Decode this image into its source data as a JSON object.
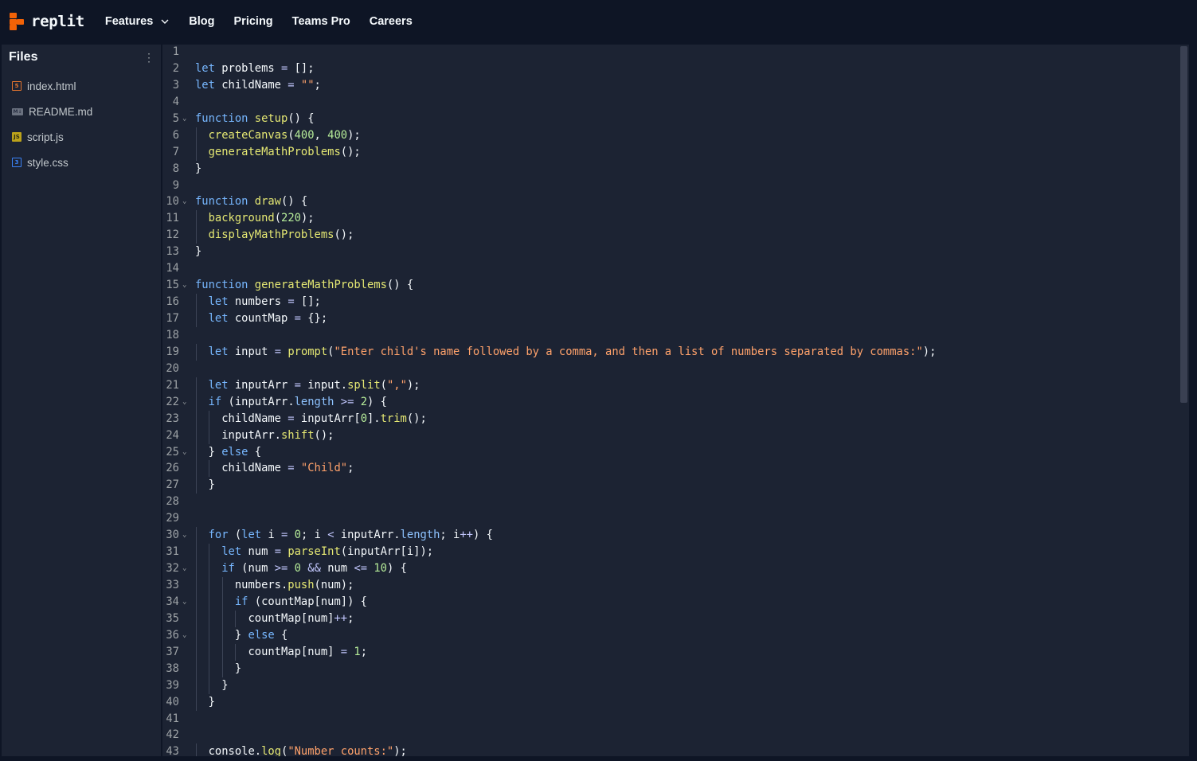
{
  "brand": {
    "name": "replit",
    "accent": "#f26207"
  },
  "nav": {
    "items": [
      "Features",
      "Blog",
      "Pricing",
      "Teams Pro",
      "Careers"
    ]
  },
  "sidebar": {
    "title": "Files",
    "menu_icon": "kebab-menu-icon",
    "files": [
      {
        "name": "index.html",
        "icon": "html5-icon"
      },
      {
        "name": "README.md",
        "icon": "markdown-icon"
      },
      {
        "name": "script.js",
        "icon": "javascript-icon"
      },
      {
        "name": "style.css",
        "icon": "css3-icon"
      }
    ]
  },
  "editor": {
    "lines": [
      {
        "n": "1",
        "code": ""
      },
      {
        "n": "2",
        "code": "let problems = [];"
      },
      {
        "n": "3",
        "code": "let childName = \"\";"
      },
      {
        "n": "4",
        "code": ""
      },
      {
        "n": "5",
        "code": "function setup() {",
        "fold": true
      },
      {
        "n": "6",
        "code": "  createCanvas(400, 400);"
      },
      {
        "n": "7",
        "code": "  generateMathProblems();"
      },
      {
        "n": "8",
        "code": "}"
      },
      {
        "n": "9",
        "code": ""
      },
      {
        "n": "10",
        "code": "function draw() {",
        "fold": true
      },
      {
        "n": "11",
        "code": "  background(220);"
      },
      {
        "n": "12",
        "code": "  displayMathProblems();"
      },
      {
        "n": "13",
        "code": "}"
      },
      {
        "n": "14",
        "code": ""
      },
      {
        "n": "15",
        "code": "function generateMathProblems() {",
        "fold": true
      },
      {
        "n": "16",
        "code": "  let numbers = [];"
      },
      {
        "n": "17",
        "code": "  let countMap = {};"
      },
      {
        "n": "18",
        "code": ""
      },
      {
        "n": "19",
        "code": "  let input = prompt(\"Enter child's name followed by a comma, and then a list of numbers separated by commas:\");"
      },
      {
        "n": "20",
        "code": ""
      },
      {
        "n": "21",
        "code": "  let inputArr = input.split(\",\");"
      },
      {
        "n": "22",
        "code": "  if (inputArr.length >= 2) {",
        "fold": true
      },
      {
        "n": "23",
        "code": "    childName = inputArr[0].trim();"
      },
      {
        "n": "24",
        "code": "    inputArr.shift();"
      },
      {
        "n": "25",
        "code": "  } else {",
        "fold": true
      },
      {
        "n": "26",
        "code": "    childName = \"Child\";"
      },
      {
        "n": "27",
        "code": "  }"
      },
      {
        "n": "28",
        "code": ""
      },
      {
        "n": "29",
        "code": ""
      },
      {
        "n": "30",
        "code": "  for (let i = 0; i < inputArr.length; i++) {",
        "fold": true
      },
      {
        "n": "31",
        "code": "    let num = parseInt(inputArr[i]);"
      },
      {
        "n": "32",
        "code": "    if (num >= 0 && num <= 10) {",
        "fold": true
      },
      {
        "n": "33",
        "code": "      numbers.push(num);"
      },
      {
        "n": "34",
        "code": "      if (countMap[num]) {",
        "fold": true
      },
      {
        "n": "35",
        "code": "        countMap[num]++;"
      },
      {
        "n": "36",
        "code": "      } else {",
        "fold": true
      },
      {
        "n": "37",
        "code": "        countMap[num] = 1;"
      },
      {
        "n": "38",
        "code": "      }"
      },
      {
        "n": "39",
        "code": "    }"
      },
      {
        "n": "40",
        "code": "  }"
      },
      {
        "n": "41",
        "code": ""
      },
      {
        "n": "42",
        "code": ""
      },
      {
        "n": "43",
        "code": "  console.log(\"Number counts:\");"
      }
    ]
  }
}
